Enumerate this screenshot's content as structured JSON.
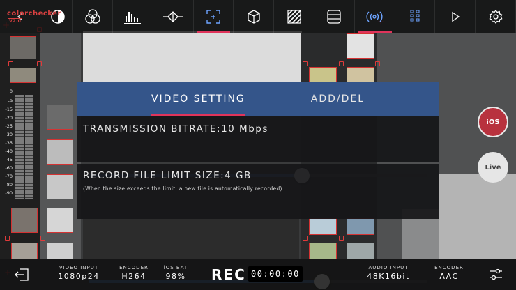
{
  "brand": {
    "name": "colorchecker",
    "badge": "V2.0"
  },
  "topbar": {
    "items": [
      {
        "name": "back-icon",
        "active": false
      },
      {
        "name": "color-wheel-icon",
        "active": false
      },
      {
        "name": "histogram-icon",
        "active": false
      },
      {
        "name": "waveform-icon",
        "active": false
      },
      {
        "name": "focus-frame-icon",
        "active": true
      },
      {
        "name": "cube-icon",
        "active": false
      },
      {
        "name": "zebra-icon",
        "active": false
      },
      {
        "name": "grid-lines-icon",
        "active": false
      },
      {
        "name": "broadcast-icon",
        "active": true
      },
      {
        "name": "vu-meter-icon",
        "active": false
      },
      {
        "name": "play-icon",
        "active": false
      },
      {
        "name": "settings-gear-icon",
        "active": false
      }
    ]
  },
  "meter": {
    "labels": [
      "0",
      "-9",
      "-15",
      "-20",
      "-25",
      "-30",
      "-35",
      "-40",
      "-45",
      "-60",
      "-70",
      "-80",
      "-90"
    ]
  },
  "modal": {
    "tabs": [
      {
        "label": "VIDEO SETTING",
        "active": true
      },
      {
        "label": "ADD/DEL",
        "active": false
      }
    ],
    "bitrate": {
      "title": "TRANSMISSION BITRATE:10 Mbps",
      "level": 0.63
    },
    "record_limit": {
      "title": "RECORD FILE LIMIT SIZE:4 GB",
      "hint": "(When the size exceeds the limit, a new file is automatically recorded)",
      "level": 0.69
    }
  },
  "side_buttons": {
    "ios": "iOS",
    "live": "Live"
  },
  "bottombar": {
    "video_input": {
      "label": "VIDEO INPUT",
      "value": "1080p24"
    },
    "encoder_video": {
      "label": "ENCODER",
      "value": "H264"
    },
    "ios_bat": {
      "label": "iOS BAT",
      "value": "98%"
    },
    "rec_label": "REC",
    "timer": "00:00:00",
    "audio_input": {
      "label": "AUDIO INPUT",
      "value": "48K16bit"
    },
    "encoder_audio": {
      "label": "ENCODER",
      "value": "AAC"
    }
  },
  "colors": {
    "accent": "#e0345b",
    "tab_bar": "#34558a",
    "slider_fill": "#4d77b5",
    "ios_button": "#b8323e"
  }
}
